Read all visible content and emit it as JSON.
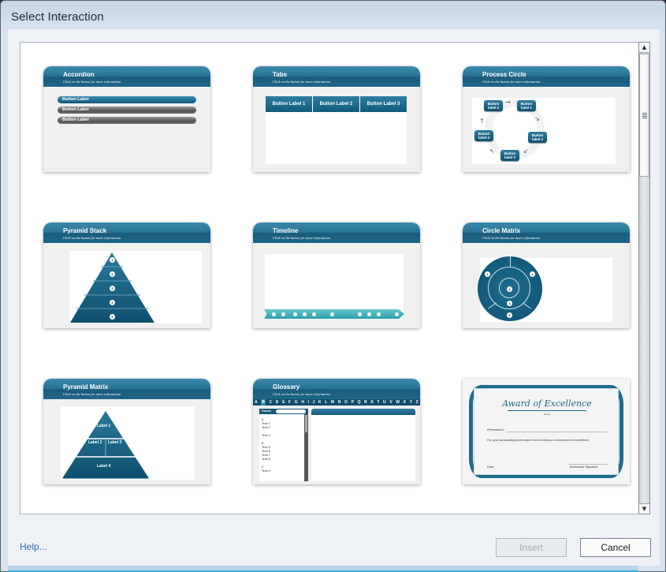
{
  "window": {
    "title": "Select Interaction"
  },
  "cards": [
    {
      "id": "accordion",
      "title": "Accordion",
      "subtitle": "Click on the button for more information",
      "buttons": [
        "Button Label",
        "Button Label",
        "Button Label"
      ]
    },
    {
      "id": "tabs",
      "title": "Tabs",
      "subtitle": "Click on the button for more information",
      "tabs": [
        "Button Label 1",
        "Button Label 2",
        "Button Label 3"
      ]
    },
    {
      "id": "process-circle",
      "title": "Process Circle",
      "subtitle": "Click on the button for more information",
      "nodes": [
        "Button label 5",
        "Button label 1",
        "Button label 2",
        "Button label 3",
        "Button label 4"
      ]
    },
    {
      "id": "pyramid-stack",
      "title": "Pyramid Stack",
      "subtitle": "Click on the button for more information",
      "levels": [
        "1",
        "2",
        "3",
        "4",
        "5"
      ]
    },
    {
      "id": "timeline",
      "title": "Timeline",
      "subtitle": "Click on the button for more information"
    },
    {
      "id": "circle-matrix",
      "title": "Circle Matrix",
      "subtitle": "Click on the button for more information",
      "markers": [
        "1",
        "2",
        "3",
        "4",
        "5"
      ]
    },
    {
      "id": "pyramid-matrix",
      "title": "Pyramid Matrix",
      "subtitle": "Click on the button for more information",
      "labels": [
        "Label 1",
        "Label 2",
        "Label 3",
        "Label 4"
      ]
    },
    {
      "id": "glossary",
      "title": "Glossary",
      "subtitle": "Click on the button for more information",
      "letters": [
        "A",
        "B",
        "C",
        "D",
        "E",
        "F",
        "G",
        "H",
        "I",
        "J",
        "K",
        "L",
        "M",
        "N",
        "O",
        "P",
        "Q",
        "R",
        "S",
        "T",
        "U",
        "V",
        "W",
        "X",
        "Y",
        "Z"
      ],
      "active_letter": "B",
      "search_label": "Search",
      "entries": [
        "A",
        "Term 1",
        "Term 2",
        "",
        "Term 4",
        "",
        "B",
        "Term 5",
        "Term 6",
        "Term 7",
        "Term 8",
        "",
        "C",
        "Term 9"
      ]
    },
    {
      "id": "certificate",
      "title": "Award of Excellence",
      "presented_to": "Presented to",
      "body": "For your outstanding performance and continuous commitment to excellence.",
      "date_label": "Date:",
      "signature_label": "Authorized Signature"
    }
  ],
  "footer": {
    "help_link": "Help...",
    "insert_label": "Insert",
    "cancel_label": "Cancel"
  },
  "colors": {
    "accent": "#1d6b8c",
    "link": "#2f6fb7"
  }
}
